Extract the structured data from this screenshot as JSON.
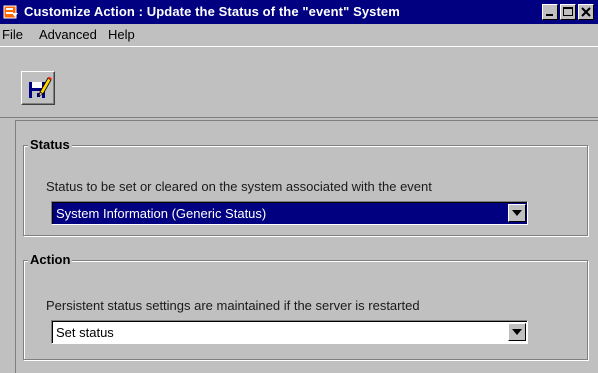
{
  "window": {
    "title": "Customize Action : Update the Status of the \"event\" System"
  },
  "menu": {
    "items": [
      "File",
      "Advanced",
      "Help"
    ]
  },
  "toolbar": {
    "save_icon": "save-icon"
  },
  "status_group": {
    "title": "Status",
    "description": "Status to be set or cleared on the system associated with the event",
    "selected_value": "System Information (Generic Status)"
  },
  "action_group": {
    "title": "Action",
    "description": "Persistent status settings are maintained if the server is restarted",
    "selected_value": "Set status"
  },
  "colors": {
    "titlebar": "#000080",
    "window_bg": "#c0c0c0",
    "selection": "#000080"
  }
}
